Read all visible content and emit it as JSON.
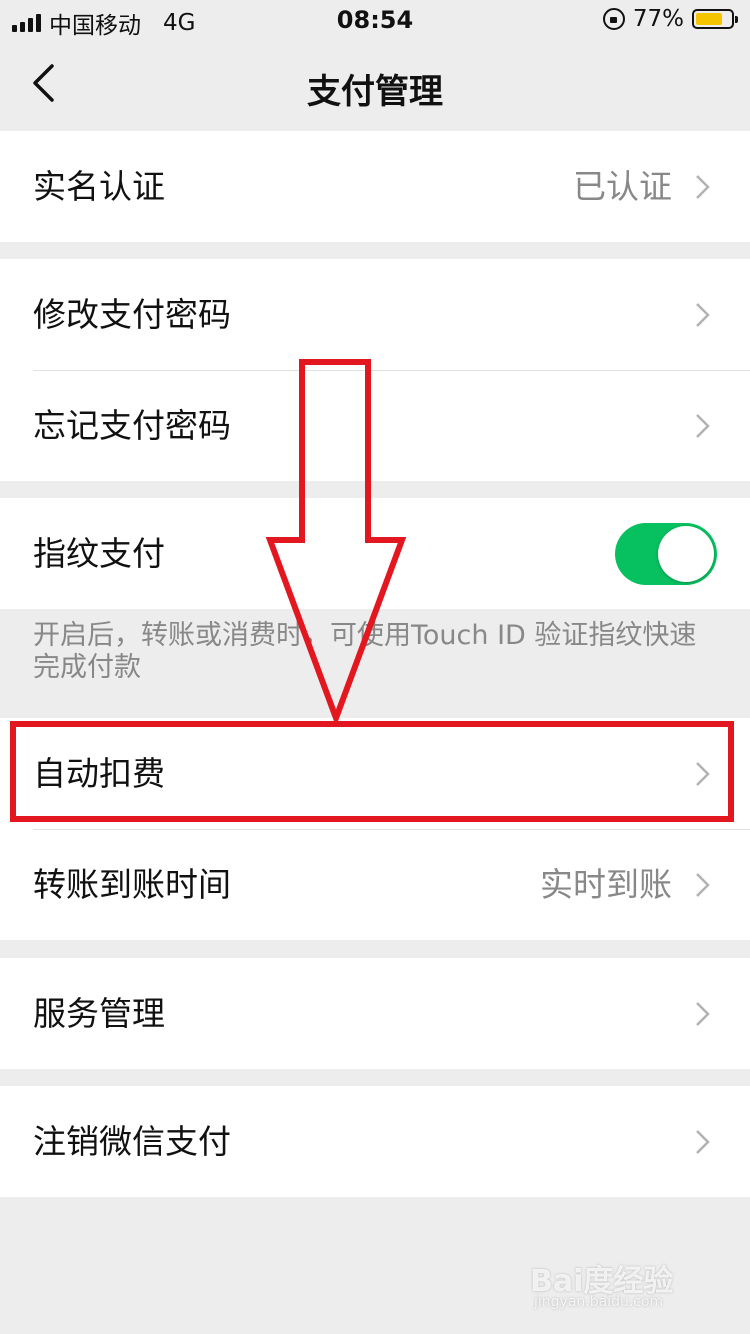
{
  "status_bar": {
    "carrier": "中国移动",
    "network": "4G",
    "time": "08:54",
    "battery": "77%",
    "battery_level": 0.77,
    "battery_color": "#f5c400"
  },
  "nav": {
    "title": "支付管理",
    "back_icon": "chevron-left-icon"
  },
  "rows": {
    "real_name": {
      "label": "实名认证",
      "value": "已认证"
    },
    "change_password": {
      "label": "修改支付密码"
    },
    "forgot_password": {
      "label": "忘记支付密码"
    },
    "fingerprint": {
      "label": "指纹支付",
      "enabled": true
    },
    "auto_debit": {
      "label": "自动扣费"
    },
    "transfer_time": {
      "label": "转账到账时间",
      "value": "实时到账"
    },
    "service_management": {
      "label": "服务管理"
    },
    "cancel_wechat_pay": {
      "label": "注销微信支付"
    }
  },
  "fingerprint_hint": "开启后，转账或消费时，可使用Touch ID 验证指纹快速完成付款",
  "colors": {
    "accent_green": "#07c160",
    "annotation_red": "#e3171f",
    "background": "#ededed"
  },
  "watermark": {
    "text": "Bai度经验",
    "sub": "jingyan.baidu.com"
  }
}
